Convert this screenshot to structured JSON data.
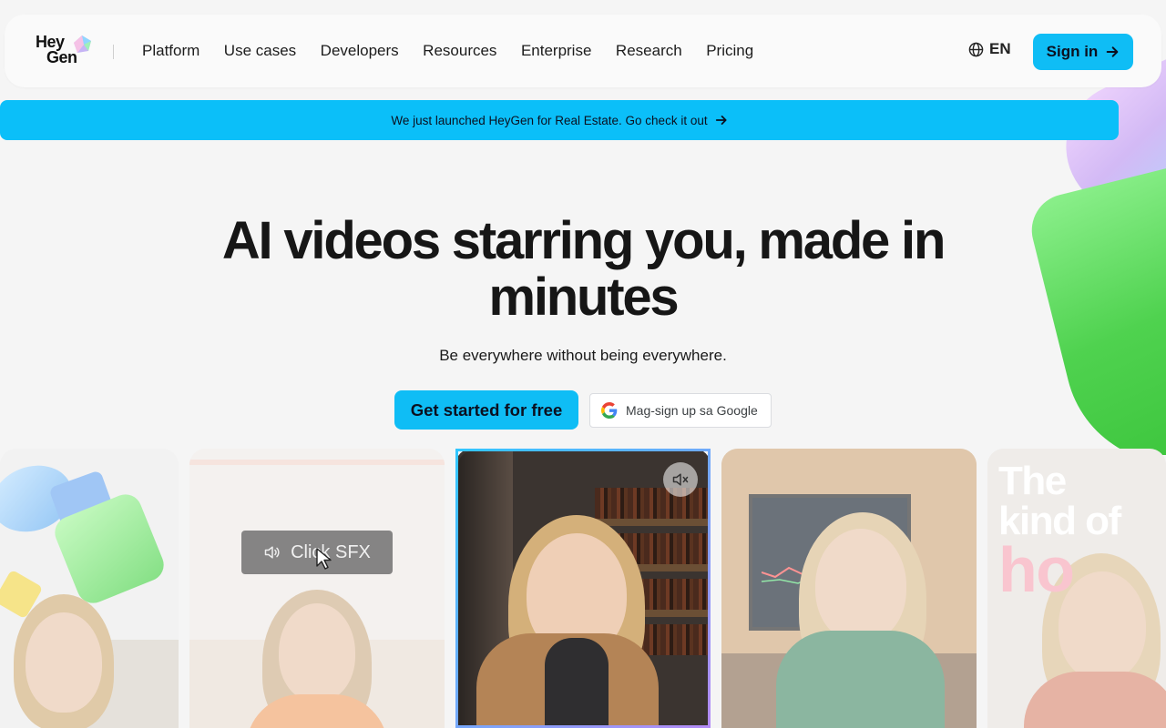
{
  "brand": {
    "logo_line1": "Hey",
    "logo_line2": "Gen"
  },
  "nav": {
    "links": [
      "Platform",
      "Use cases",
      "Developers",
      "Resources",
      "Enterprise",
      "Research",
      "Pricing"
    ],
    "language": "EN",
    "signin_label": "Sign in"
  },
  "banner": {
    "text": "We just launched HeyGen for Real Estate. Go check it out"
  },
  "hero": {
    "title": "AI videos starring you, made in minutes",
    "subtitle": "Be everywhere without being everywhere.",
    "cta_label": "Get started for free",
    "google_label": "Mag-sign up sa Google"
  },
  "videos": {
    "sfx_label": "Click SFX",
    "card4_line1": "The",
    "card4_line2": "kind of",
    "card4_line3": "ho"
  },
  "colors": {
    "accent": "#0fbdf5",
    "banner": "#0bbff9",
    "green": "#4fd24f"
  }
}
